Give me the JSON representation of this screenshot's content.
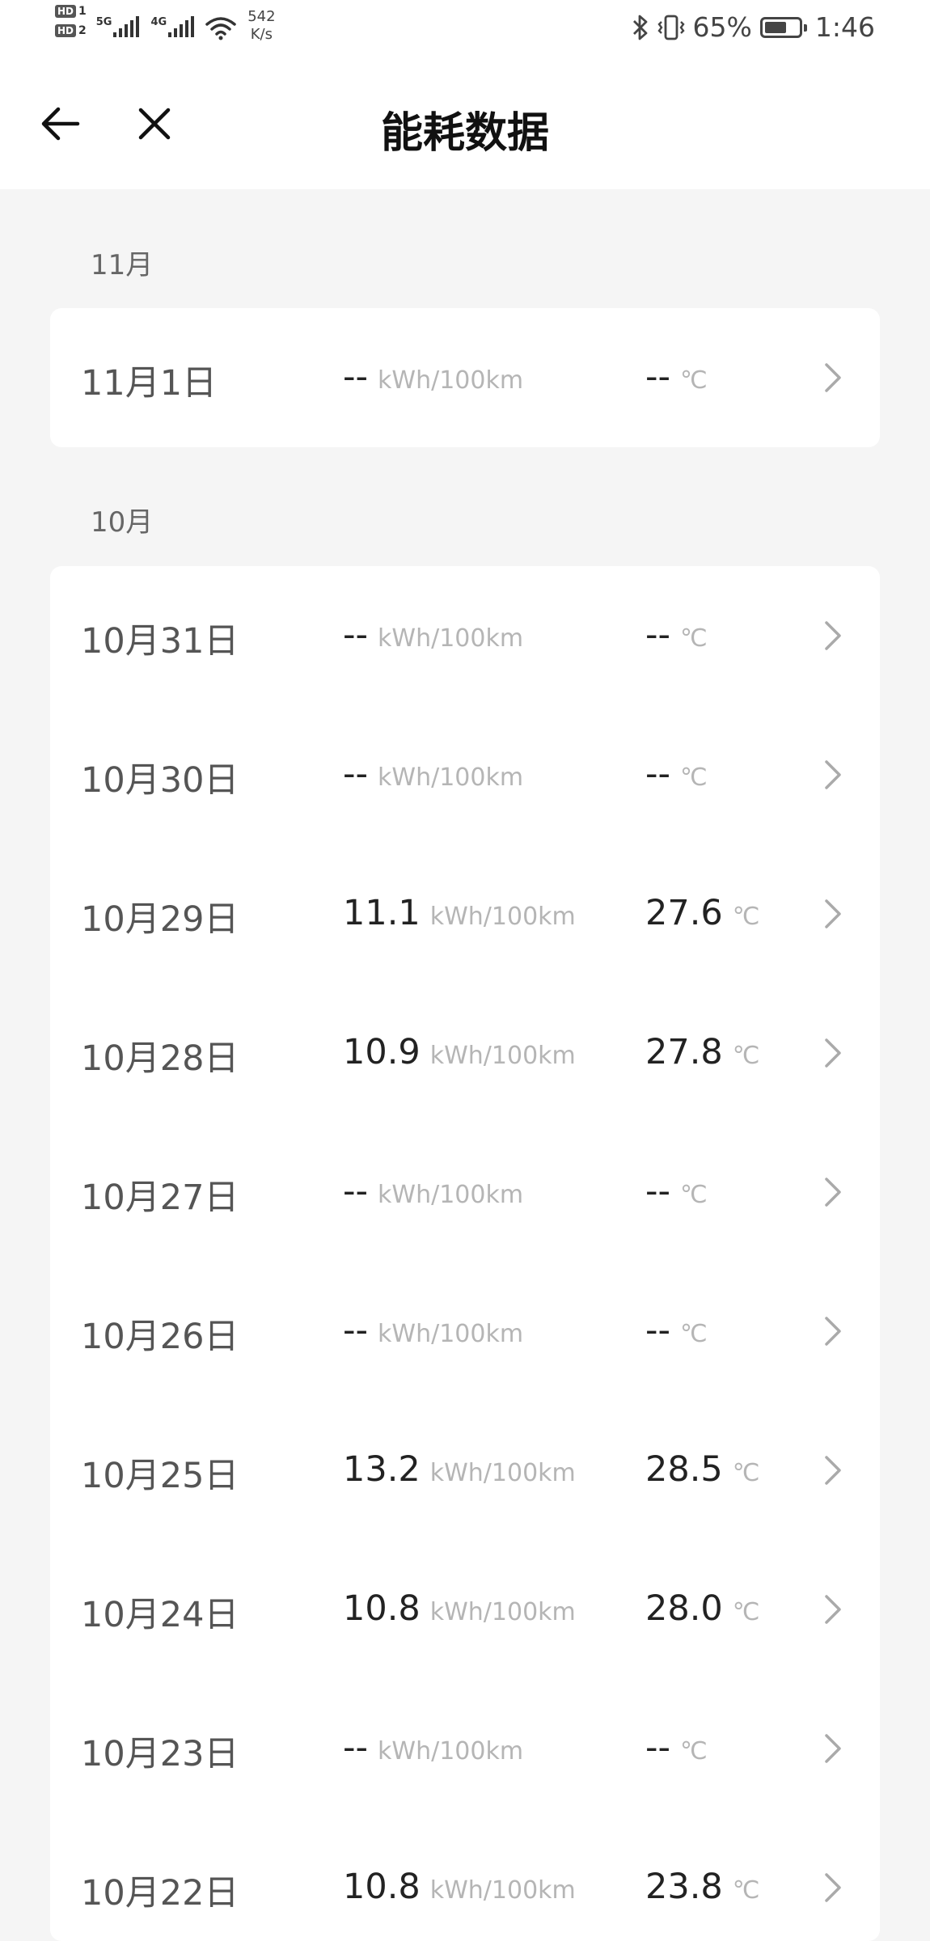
{
  "status_bar": {
    "sim1": "HD",
    "sim1_num": "1",
    "sim2": "HD",
    "sim2_num": "2",
    "net1": "5G",
    "net2": "4G",
    "speed_value": "542",
    "speed_unit": "K/s",
    "battery_percent": "65%",
    "battery_level": 0.65,
    "time": "1:46"
  },
  "nav": {
    "title": "能耗数据",
    "back_icon": "arrow-left-icon",
    "close_icon": "close-icon"
  },
  "sections": [
    {
      "label": "11月",
      "rows": [
        {
          "date": "11月1日",
          "energy": "--",
          "energy_unit": "kWh/100km",
          "temp": "--",
          "temp_unit": "℃"
        }
      ]
    },
    {
      "label": "10月",
      "rows": [
        {
          "date": "10月31日",
          "energy": "--",
          "energy_unit": "kWh/100km",
          "temp": "--",
          "temp_unit": "℃"
        },
        {
          "date": "10月30日",
          "energy": "--",
          "energy_unit": "kWh/100km",
          "temp": "--",
          "temp_unit": "℃"
        },
        {
          "date": "10月29日",
          "energy": "11.1",
          "energy_unit": "kWh/100km",
          "temp": "27.6",
          "temp_unit": "℃"
        },
        {
          "date": "10月28日",
          "energy": "10.9",
          "energy_unit": "kWh/100km",
          "temp": "27.8",
          "temp_unit": "℃"
        },
        {
          "date": "10月27日",
          "energy": "--",
          "energy_unit": "kWh/100km",
          "temp": "--",
          "temp_unit": "℃"
        },
        {
          "date": "10月26日",
          "energy": "--",
          "energy_unit": "kWh/100km",
          "temp": "--",
          "temp_unit": "℃"
        },
        {
          "date": "10月25日",
          "energy": "13.2",
          "energy_unit": "kWh/100km",
          "temp": "28.5",
          "temp_unit": "℃"
        },
        {
          "date": "10月24日",
          "energy": "10.8",
          "energy_unit": "kWh/100km",
          "temp": "28.0",
          "temp_unit": "℃"
        },
        {
          "date": "10月23日",
          "energy": "--",
          "energy_unit": "kWh/100km",
          "temp": "--",
          "temp_unit": "℃"
        },
        {
          "date": "10月22日",
          "energy": "10.8",
          "energy_unit": "kWh/100km",
          "temp": "23.8",
          "temp_unit": "℃"
        }
      ]
    }
  ],
  "colors": {
    "background": "#f5f5f5",
    "card": "#ffffff",
    "value_text": "#222222",
    "date_text": "#555555",
    "unit_text": "#b5b5b5",
    "chevron": "#aaaaaa"
  }
}
